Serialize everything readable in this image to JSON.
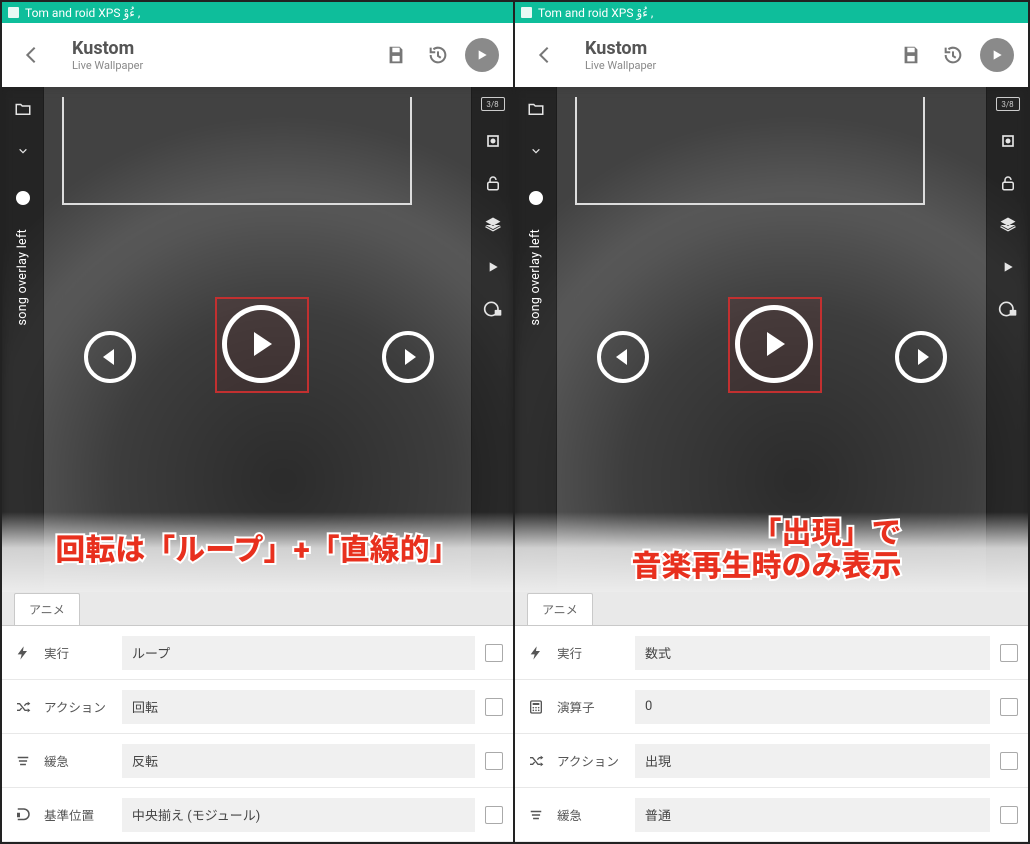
{
  "statusbar": {
    "text": "Tom and roid XPS ءُوْ ,"
  },
  "toolbar": {
    "title": "Kustom",
    "subtitle": "Live Wallpaper",
    "icons": {
      "back": "back-icon",
      "save": "save-icon",
      "history": "history-icon",
      "play": "play-icon"
    }
  },
  "left_rail": {
    "label": "song overlay left"
  },
  "right_rail": {
    "badge": "3/8"
  },
  "tab": {
    "label": "アニメ"
  },
  "panels": [
    {
      "caption": "回転は「ループ」+「直線的」",
      "rows": [
        {
          "icon": "bolt-icon",
          "label": "実行",
          "value": "ループ"
        },
        {
          "icon": "shuffle-icon",
          "label": "アクション",
          "value": "回転"
        },
        {
          "icon": "lines-icon",
          "label": "緩急",
          "value": "反転"
        },
        {
          "icon": "anchor-icon",
          "label": "基準位置",
          "value": "中央揃え (モジュール)"
        }
      ]
    },
    {
      "caption": "「出現」で\n音楽再生時のみ表示",
      "rows": [
        {
          "icon": "bolt-icon",
          "label": "実行",
          "value": "数式"
        },
        {
          "icon": "calc-icon",
          "label": "演算子",
          "value": "0"
        },
        {
          "icon": "shuffle-icon",
          "label": "アクション",
          "value": "出現"
        },
        {
          "icon": "lines-icon",
          "label": "緩急",
          "value": "普通"
        }
      ]
    }
  ]
}
